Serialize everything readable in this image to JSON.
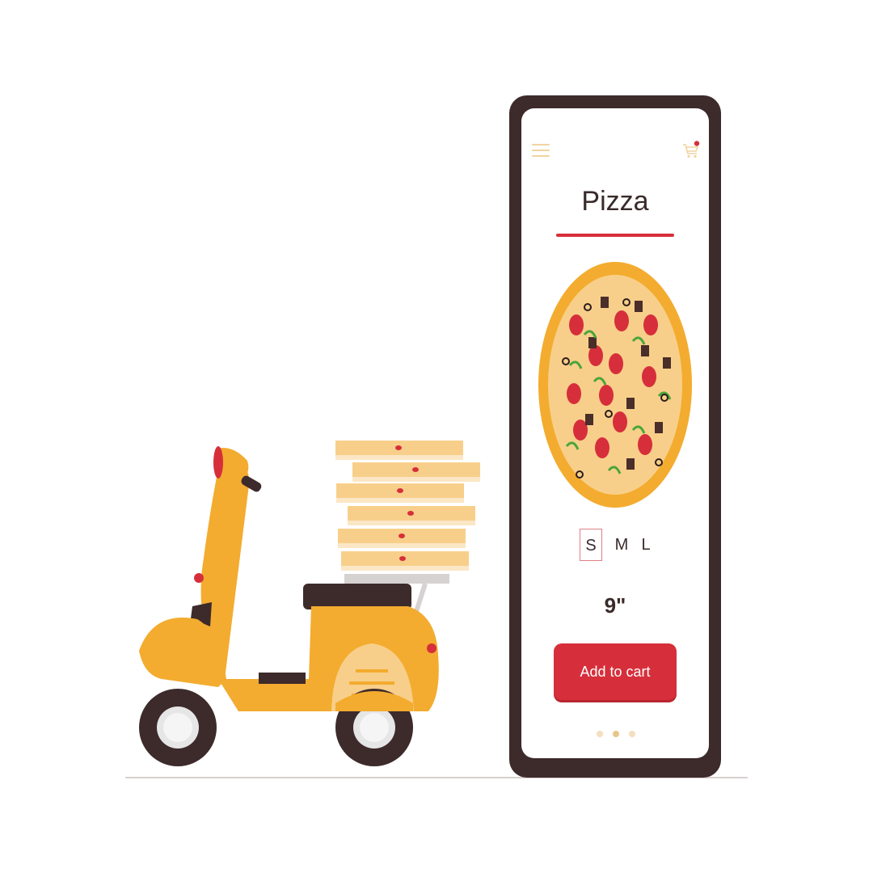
{
  "screen": {
    "title": "Pizza",
    "sizes": [
      "S",
      "M",
      "L"
    ],
    "selected_size": "S",
    "size_value": "9\"",
    "add_to_cart_label": "Add to cart",
    "carousel": {
      "count": 3,
      "active_index": 1
    }
  },
  "icons": {
    "menu": "hamburger-menu-icon",
    "cart": "shopping-cart-icon",
    "cart_badge": "notification-dot-icon"
  },
  "colors": {
    "accent": "#d62f3b",
    "phone_frame": "#3d2a2b",
    "scooter": "#f3ac2f",
    "pizza_crust": "#f3ac2f",
    "box": "#f8cf8a"
  }
}
